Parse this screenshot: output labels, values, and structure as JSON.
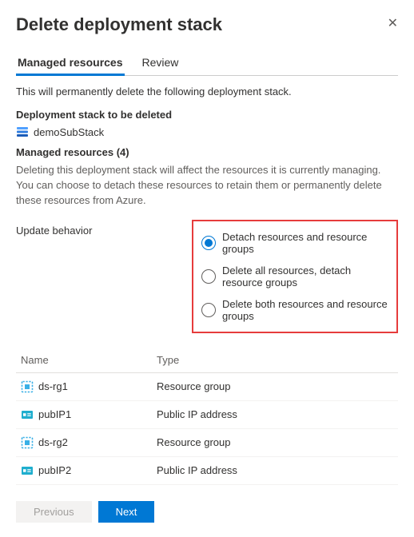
{
  "title": "Delete deployment stack",
  "tabs": {
    "managed": "Managed resources",
    "review": "Review"
  },
  "intro": "This will permanently delete the following deployment stack.",
  "stackToDeleteHeader": "Deployment stack to be deleted",
  "stackName": "demoSubStack",
  "managedResourcesHeader": "Managed resources (4)",
  "managedResourcesDesc": "Deleting this deployment stack will affect the resources it is currently managing. You can choose to detach these resources to retain them or permanently delete these resources from Azure.",
  "updateBehaviorLabel": "Update behavior",
  "radios": {
    "detach": "Detach resources and resource groups",
    "deleteAll": "Delete all resources, detach resource groups",
    "deleteBoth": "Delete both resources and resource groups"
  },
  "columns": {
    "name": "Name",
    "type": "Type"
  },
  "rows": [
    {
      "name": "ds-rg1",
      "type": "Resource group",
      "icon": "rg"
    },
    {
      "name": "pubIP1",
      "type": "Public IP address",
      "icon": "ip"
    },
    {
      "name": "ds-rg2",
      "type": "Resource group",
      "icon": "rg"
    },
    {
      "name": "pubIP2",
      "type": "Public IP address",
      "icon": "ip"
    }
  ],
  "buttons": {
    "previous": "Previous",
    "next": "Next"
  }
}
